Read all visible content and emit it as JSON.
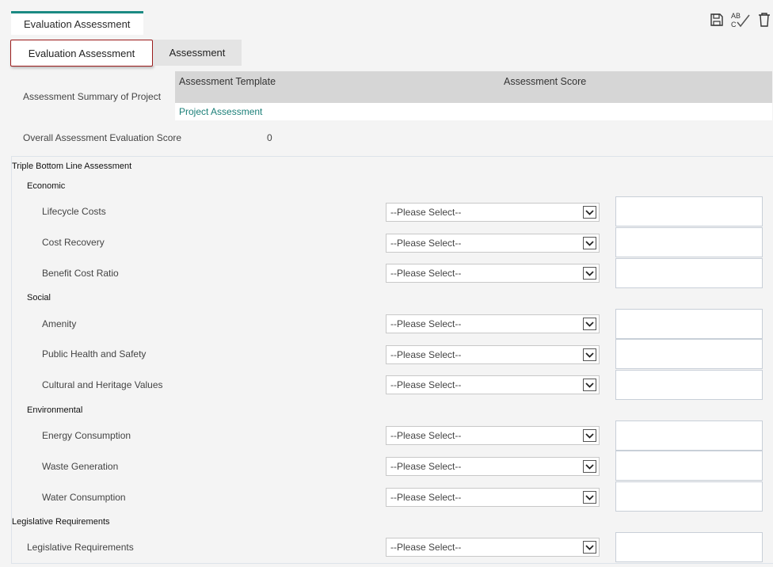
{
  "page_tab": {
    "label": "Evaluation Assessment"
  },
  "toolbar": {
    "save_icon": "save-icon",
    "spellcheck_icon": "spellcheck-icon",
    "spellcheck_text": "AB C",
    "delete_icon": "trash-icon"
  },
  "subtabs": [
    {
      "label": "Evaluation Assessment",
      "active": true
    },
    {
      "label": "Assessment",
      "active": false
    }
  ],
  "summary": {
    "label": "Assessment Summary of Project",
    "columns": [
      "Assessment Template",
      "Assessment Score"
    ],
    "rows": [
      {
        "template": "Project Assessment",
        "score": ""
      }
    ]
  },
  "overall": {
    "label": "Overall Assessment Evaluation Score",
    "value": "0"
  },
  "tbl": {
    "title": "Triple Bottom Line Assessment",
    "groups": [
      {
        "name": "Economic",
        "items": [
          "Lifecycle Costs",
          "Cost Recovery",
          "Benefit Cost Ratio"
        ]
      },
      {
        "name": "Social",
        "items": [
          "Amenity",
          "Public Health and Safety",
          "Cultural and Heritage Values"
        ]
      },
      {
        "name": "Environmental",
        "items": [
          "Energy Consumption",
          "Waste Generation",
          "Water Consumption"
        ]
      }
    ]
  },
  "legislative": {
    "title": "Legislative Requirements",
    "items": [
      "Legislative Requirements"
    ]
  },
  "select_placeholder": "--Please Select--",
  "colors": {
    "accent": "#1b8a83",
    "active_tab_border": "#9b1c1c",
    "header_bg": "#d6d6d6"
  }
}
